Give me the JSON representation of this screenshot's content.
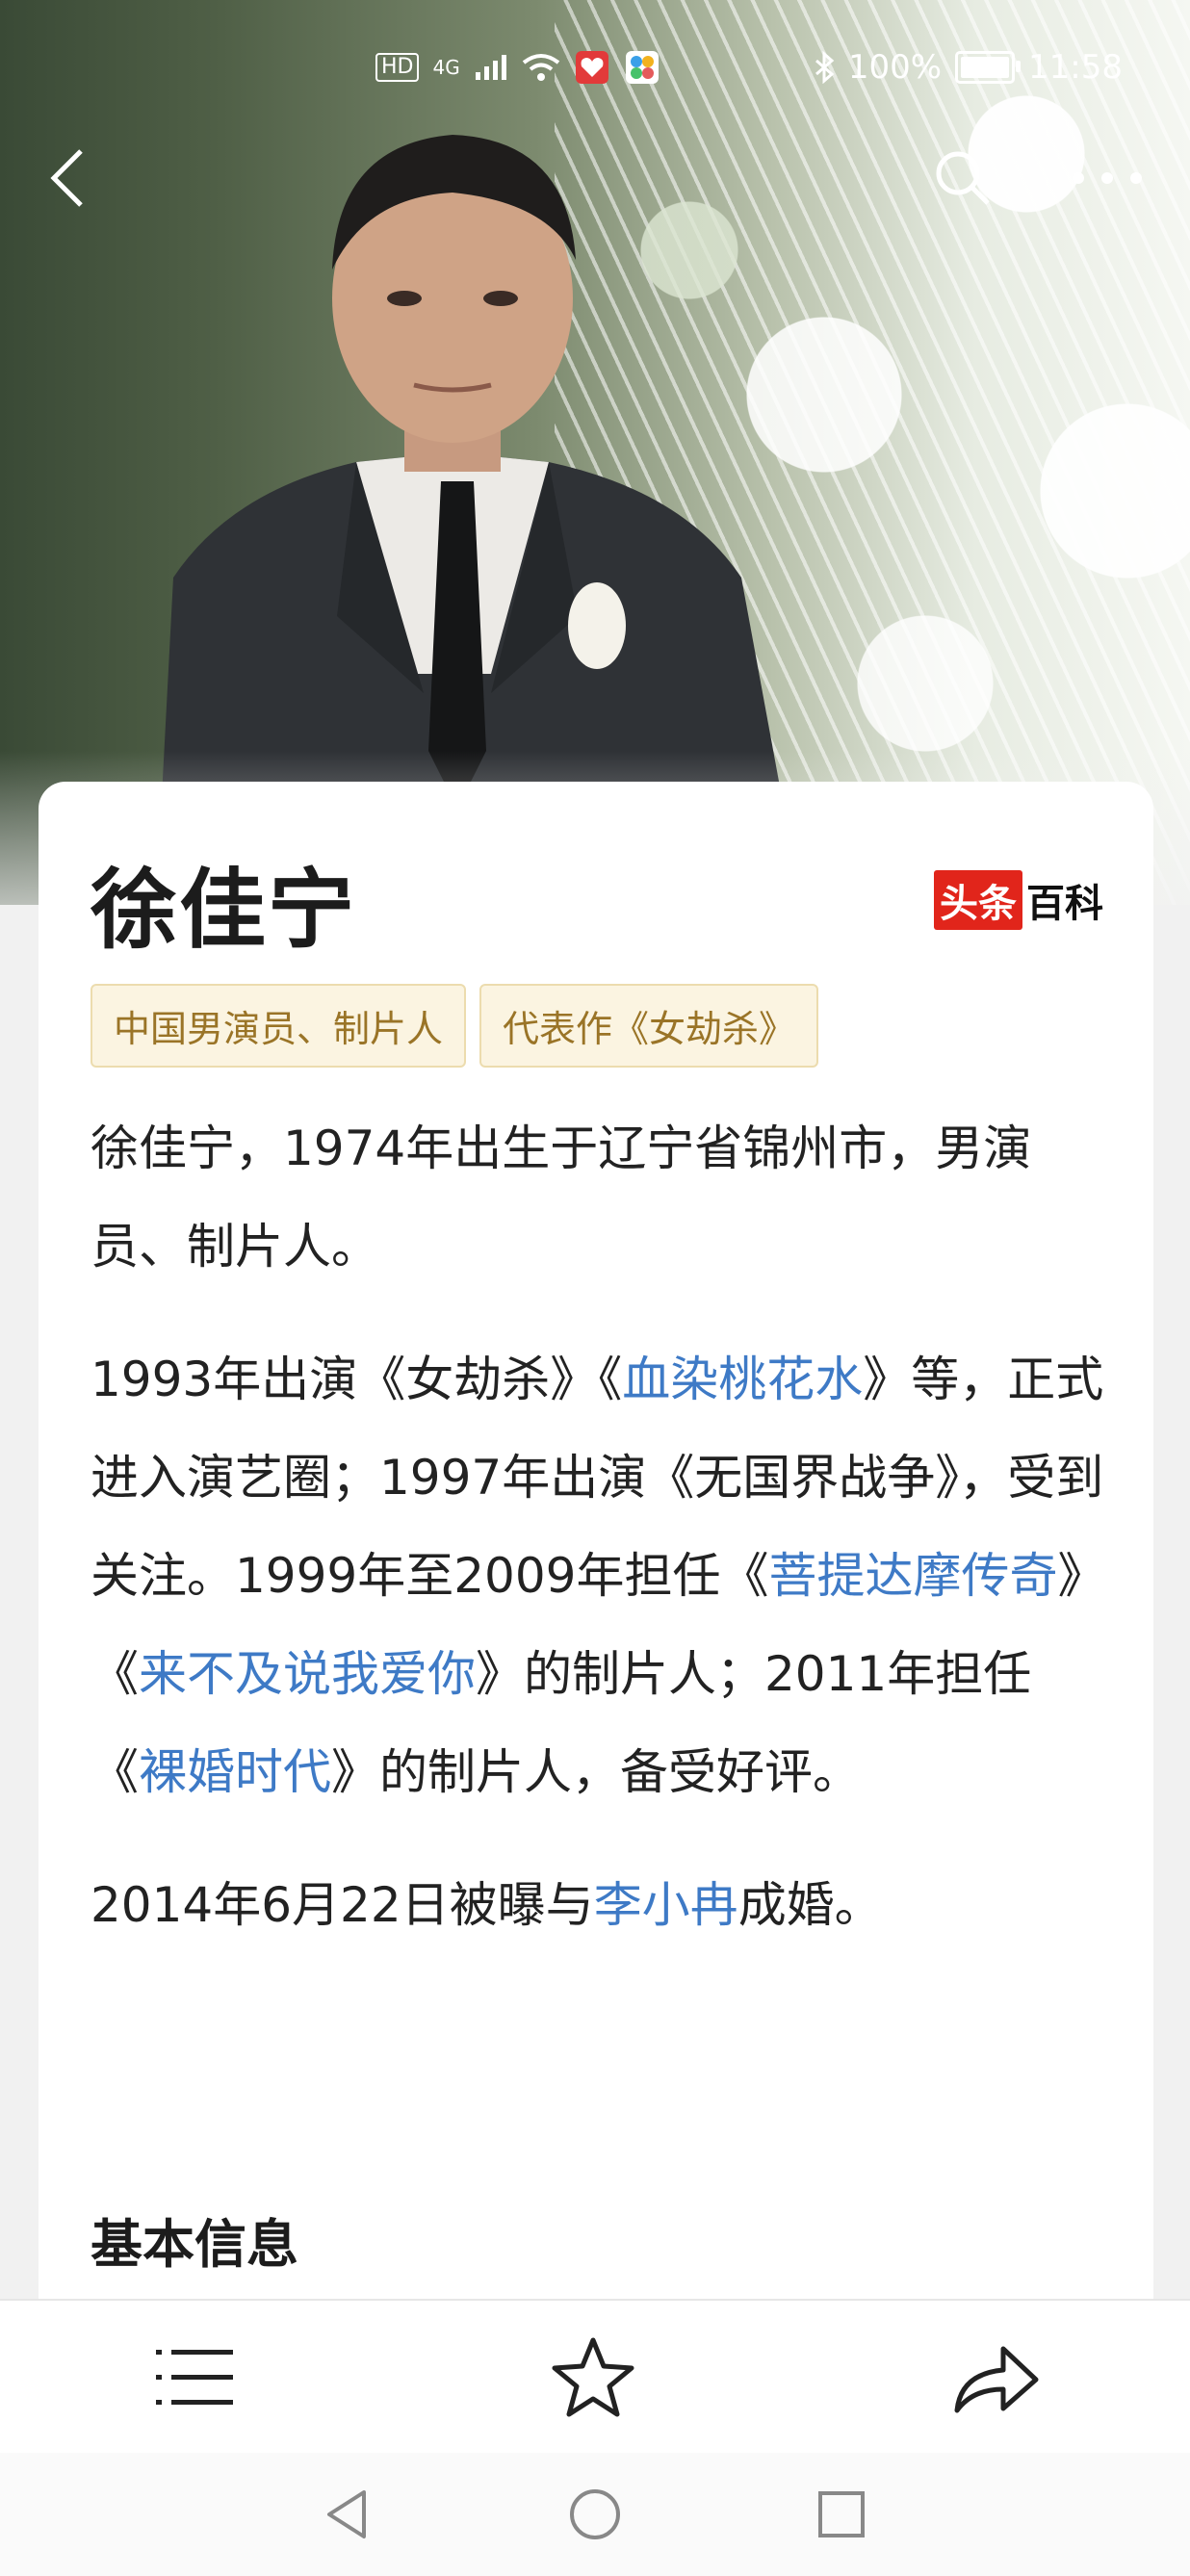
{
  "status_bar": {
    "left_chips": [
      "HD",
      "4G"
    ],
    "battery_text": "100%",
    "battery_level": 1.0,
    "time": "11:58"
  },
  "nav": {
    "back_icon": "chevron-left-icon",
    "search_icon": "search-icon",
    "more_icon": "more-dots-icon"
  },
  "article": {
    "title": "徐佳宁",
    "brand_red": "头条",
    "brand_black": "百科",
    "tags": [
      "中国男演员、制片人",
      "代表作《女劫杀》"
    ],
    "para1": "徐佳宁，1974年出生于辽宁省锦州市，男演员、制片人。",
    "para2": {
      "t1": "1993年出演《女劫杀》《",
      "link1": "血染桃花水",
      "t2": "》等，正式进入演艺圈；1997年出演《无国界战争》，受到关注。1999年至2009年担任《",
      "link2": "菩提达摩传奇",
      "t3": "》《",
      "link3": "来不及说我爱你",
      "t4": "》的制片人；2011年担任《",
      "link4": "裸婚时代",
      "t5": "》的制片人，备受好评。"
    },
    "para3": {
      "t1": "2014年6月22日被曝与",
      "link1": "李小冉",
      "t2": "成婚。"
    },
    "section_basic": "基本信息"
  },
  "toolbar": {
    "menu_icon": "menu-list-icon",
    "favorite_icon": "star-icon",
    "share_icon": "share-icon"
  },
  "system_nav": {
    "back": "triangle-back-icon",
    "home": "circle-home-icon",
    "recents": "square-recents-icon"
  },
  "colors": {
    "link": "#3e7ac6",
    "tag_bg": "#fbf4e1",
    "tag_text": "#9a7427",
    "brand_red": "#e1251b"
  }
}
